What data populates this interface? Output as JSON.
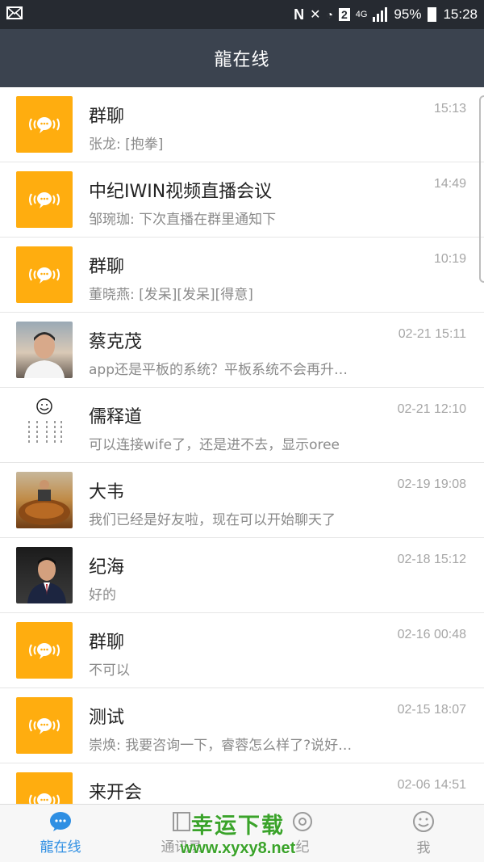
{
  "status_bar": {
    "battery": "95%",
    "time": "15:28",
    "network": "4G",
    "sim_badge": "2"
  },
  "header": {
    "title": "龍在线"
  },
  "conversations": [
    {
      "name": "群聊",
      "preview": "张龙: [抱拳]",
      "time": "15:13",
      "avatar": "group-chat-icon"
    },
    {
      "name": "中纪IWIN视频直播会议",
      "preview": "邹琬珈: 下次直播在群里通知下",
      "time": "14:49",
      "avatar": "group-chat-icon"
    },
    {
      "name": "群聊",
      "preview": "董晓燕: [发呆][发呆][得意]",
      "time": "10:19",
      "avatar": "group-chat-icon"
    },
    {
      "name": "蔡克茂",
      "preview": "app还是平板的系统？平板系统不会再升…",
      "time": "02-21 15:11",
      "avatar": "user-photo"
    },
    {
      "name": "儒释道",
      "preview": "可以连接wife了，还是进不去，显示oree",
      "time": "02-21 12:10",
      "avatar": "calligraphy-avatar"
    },
    {
      "name": "大韦",
      "preview": "我们已经是好友啦，现在可以开始聊天了",
      "time": "02-19 19:08",
      "avatar": "user-photo"
    },
    {
      "name": "纪海",
      "preview": "好的",
      "time": "02-18 15:12",
      "avatar": "user-photo"
    },
    {
      "name": "群聊",
      "preview": "不可以",
      "time": "02-16 00:48",
      "avatar": "group-chat-icon"
    },
    {
      "name": "测试",
      "preview": "崇焕: 我要咨询一下，睿蓉怎么样了?说好…",
      "time": "02-15 18:07",
      "avatar": "group-chat-icon"
    },
    {
      "name": "来开会",
      "preview": "",
      "time": "02-06 14:51",
      "avatar": "group-chat-icon"
    }
  ],
  "tabs": [
    {
      "label": "龍在线",
      "icon": "chat-bubble-icon",
      "active": true
    },
    {
      "label": "通讯录",
      "icon": "contacts-book-icon",
      "active": false
    },
    {
      "label": "纪",
      "icon": "discover-icon",
      "active": false
    },
    {
      "label": "我",
      "icon": "smiley-face-icon",
      "active": false
    }
  ],
  "watermark": {
    "title": "幸运下载",
    "url": "www.xyxy8.net"
  },
  "colors": {
    "status_bar": "#262a31",
    "title_bar": "#3b434f",
    "group_avatar": "#ffad0f",
    "active_tab": "#2f8fe3",
    "watermark": "#3aa32a"
  },
  "calligraphy_avatar_text": [
    "方法从心起",
    "活在当下",
    "让生命更加美丽"
  ]
}
